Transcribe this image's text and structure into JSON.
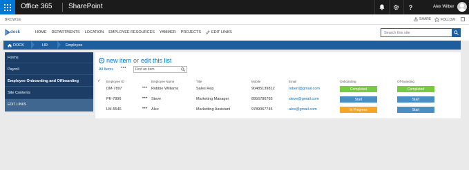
{
  "suite": {
    "brand": "Office 365",
    "app": "SharePoint",
    "user": "Alex Wilber"
  },
  "ribbon": {
    "browse": "BROWSE",
    "share": "SHARE",
    "follow": "FOLLOW"
  },
  "nav": {
    "logo": "dock",
    "items": [
      "HOME",
      "DEPARTMENTS",
      "LOCATION",
      "EMPLOYEE RESOURCES",
      "YAMMER",
      "PROJECTS"
    ],
    "edit_links": "EDIT LINKS",
    "search_placeholder": "Search this site"
  },
  "breadcrumb": [
    "DOCK",
    "HR",
    "Employee"
  ],
  "sidebar": {
    "items": [
      "Forms",
      "Payroll",
      "Employee Onboarding and Offboarding",
      "Site Contents"
    ],
    "edit_links": "EDIT LINKS"
  },
  "list": {
    "new_item": "new item",
    "or": "or",
    "edit_list": "edit this list",
    "view": "All Items",
    "find_placeholder": "Find an item",
    "columns": [
      "Employee ID",
      "Employee Name",
      "Title",
      "Mobile",
      "Email",
      "Onboarding",
      "Off-boarding"
    ],
    "rows": [
      {
        "id": "DM-7897",
        "name": "Robbie Williams",
        "title": "Sales Rep",
        "mobile": "90485139812",
        "email": "robert@gmail.com",
        "onboarding": "Completed",
        "offboarding": "Completed"
      },
      {
        "id": "PK-7896",
        "name": "Steve",
        "title": "Marketing Manager",
        "mobile": "8956786765",
        "email": "steve@gmail.com",
        "onboarding": "Start",
        "offboarding": "Start"
      },
      {
        "id": "LM-5546",
        "name": "Alex",
        "title": "Marketting Assistant",
        "mobile": "9789067745",
        "email": "alex@gmail.com",
        "onboarding": "In Progress",
        "offboarding": "Start"
      }
    ]
  },
  "colors": {
    "completed": "#7ac943",
    "start": "#4a8fc4",
    "in_progress": "#f5a623"
  }
}
